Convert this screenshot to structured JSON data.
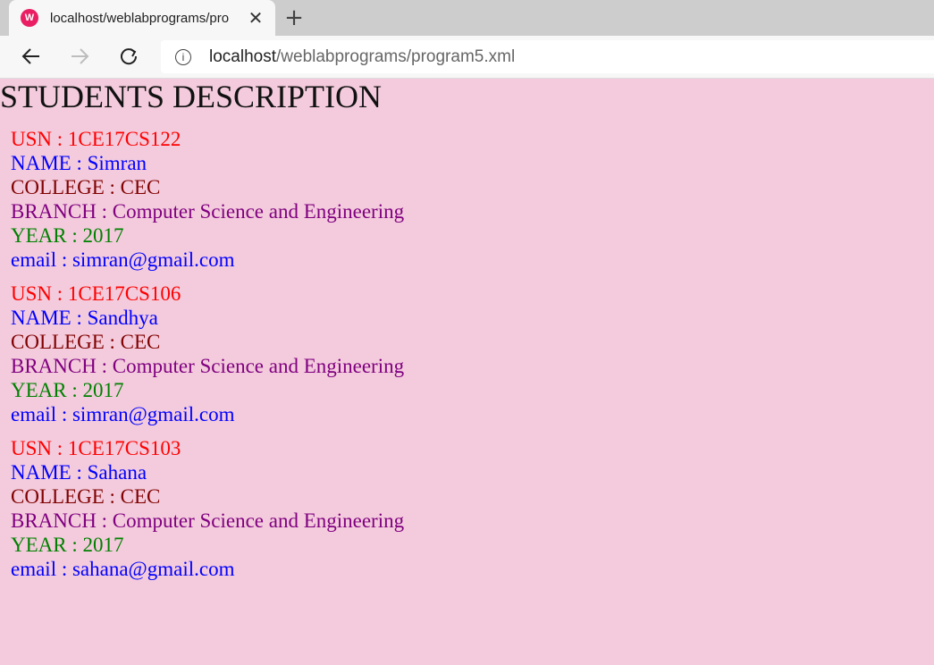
{
  "browser": {
    "tab_title": "localhost/weblabprograms/program5.xml",
    "favicon_text": "W",
    "close_symbol": "✕",
    "newtab_symbol": "+",
    "url_host": "localhost",
    "url_path": "/weblabprograms/program5.xml"
  },
  "page": {
    "heading": "STUDENTS DESCRIPTION",
    "students": [
      {
        "usn": "USN : 1CE17CS122",
        "name": "NAME : Simran",
        "college": "COLLEGE : CEC",
        "branch": "BRANCH : Computer Science and Engineering",
        "year": "YEAR : 2017",
        "email": "email : simran@gmail.com"
      },
      {
        "usn": "USN : 1CE17CS106",
        "name": "NAME : Sandhya",
        "college": "COLLEGE : CEC",
        "branch": "BRANCH : Computer Science and Engineering",
        "year": "YEAR : 2017",
        "email": "email : simran@gmail.com"
      },
      {
        "usn": "USN : 1CE17CS103",
        "name": "NAME : Sahana",
        "college": "COLLEGE : CEC",
        "branch": "BRANCH : Computer Science and Engineering",
        "year": "YEAR : 2017",
        "email": "email : sahana@gmail.com"
      }
    ]
  },
  "colors": {
    "background": "#f3cbdc",
    "usn": "#ff0000",
    "name": "#0000ff",
    "college": "#800000",
    "branch": "#800080",
    "year": "#008000",
    "email": "#0000ff"
  },
  "icons": {
    "back": "back-arrow-icon",
    "forward": "forward-arrow-icon",
    "refresh": "refresh-icon",
    "info": "info-icon",
    "favicon": "wamp-logo-icon"
  }
}
